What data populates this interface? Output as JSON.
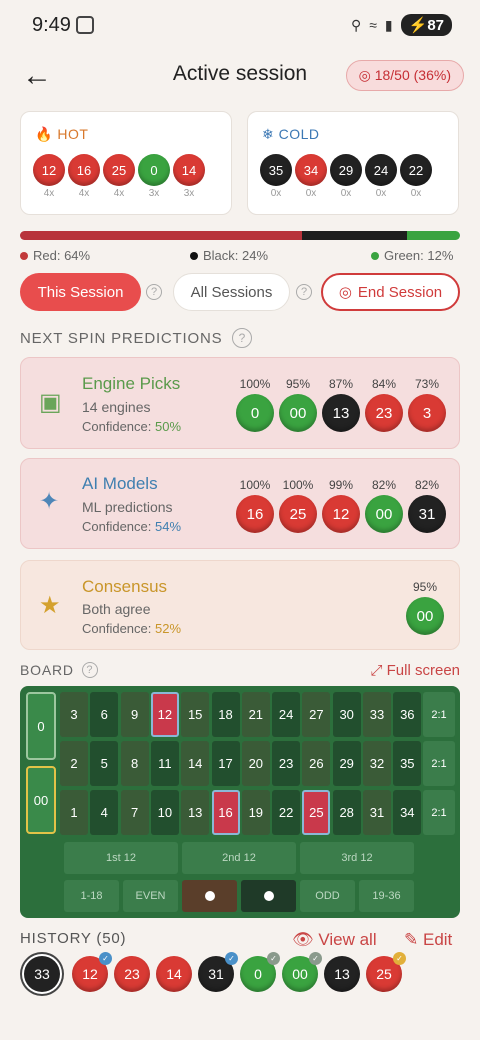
{
  "status": {
    "time": "9:49",
    "battery": "87"
  },
  "header": {
    "title": "Active session",
    "streak": "18/50 (36%)"
  },
  "hot": {
    "label": "HOT",
    "balls": [
      {
        "n": "12",
        "c": "red",
        "count": "4x"
      },
      {
        "n": "16",
        "c": "red",
        "count": "4x"
      },
      {
        "n": "25",
        "c": "red",
        "count": "4x"
      },
      {
        "n": "0",
        "c": "green",
        "count": "3x"
      },
      {
        "n": "14",
        "c": "red",
        "count": "3x"
      }
    ]
  },
  "cold": {
    "label": "COLD",
    "balls": [
      {
        "n": "35",
        "c": "black",
        "count": "0x"
      },
      {
        "n": "34",
        "c": "red",
        "count": "0x"
      },
      {
        "n": "29",
        "c": "black",
        "count": "0x"
      },
      {
        "n": "24",
        "c": "black",
        "count": "0x"
      },
      {
        "n": "22",
        "c": "black",
        "count": "0x"
      }
    ]
  },
  "ratio": {
    "red": 64,
    "black": 24,
    "green": 12,
    "red_label": "Red: 64%",
    "black_label": "Black: 24%",
    "green_label": "Green: 12%",
    "colors": {
      "red": "#b8333b",
      "black": "#1e1e1e",
      "green": "#3aa340"
    }
  },
  "buttons": {
    "this_session": "This Session",
    "all_sessions": "All Sessions",
    "end_session": "End Session",
    "q": "?"
  },
  "predictions": {
    "heading": "NEXT SPIN PREDICTIONS",
    "engine": {
      "title": "Engine Picks",
      "sub": "14 engines",
      "conf_label": "Confidence: ",
      "conf": "50%",
      "color": "#5a9a4b",
      "balls": [
        {
          "p": "100%",
          "n": "0",
          "c": "green"
        },
        {
          "p": "95%",
          "n": "00",
          "c": "green"
        },
        {
          "p": "87%",
          "n": "13",
          "c": "black"
        },
        {
          "p": "84%",
          "n": "23",
          "c": "red"
        },
        {
          "p": "73%",
          "n": "3",
          "c": "red"
        }
      ]
    },
    "ai": {
      "title": "AI Models",
      "sub": "ML predictions",
      "conf_label": "Confidence: ",
      "conf": "54%",
      "color": "#3f7fb0",
      "balls": [
        {
          "p": "100%",
          "n": "16",
          "c": "red"
        },
        {
          "p": "100%",
          "n": "25",
          "c": "red"
        },
        {
          "p": "99%",
          "n": "12",
          "c": "red"
        },
        {
          "p": "82%",
          "n": "00",
          "c": "green"
        },
        {
          "p": "82%",
          "n": "31",
          "c": "black"
        }
      ]
    },
    "consensus": {
      "title": "Consensus",
      "sub": "Both agree",
      "conf_label": "Confidence: ",
      "conf": "52%",
      "color": "#c9962a",
      "balls": [
        {
          "p": "95%",
          "n": "00",
          "c": "green"
        }
      ]
    }
  },
  "board": {
    "label": "BOARD",
    "fullscreen": "Full screen",
    "rows": [
      [
        "3",
        "6",
        "9",
        "12",
        "15",
        "18",
        "21",
        "24",
        "27",
        "30",
        "33",
        "36"
      ],
      [
        "2",
        "5",
        "8",
        "11",
        "14",
        "17",
        "20",
        "23",
        "26",
        "29",
        "32",
        "35"
      ],
      [
        "1",
        "4",
        "7",
        "10",
        "13",
        "16",
        "19",
        "22",
        "25",
        "28",
        "31",
        "34"
      ]
    ],
    "selected": [
      "12",
      "16",
      "25"
    ],
    "zero": "0",
    "double_zero": "00",
    "column": "2:1",
    "dozens": [
      "1st 12",
      "2nd 12",
      "3rd 12"
    ],
    "outside": [
      "1-18",
      "EVEN",
      "",
      "",
      "ODD",
      "19-36"
    ]
  },
  "history": {
    "label": "HISTORY (50)",
    "view_all": "View all",
    "edit": "Edit",
    "balls": [
      {
        "n": "33",
        "c": "black",
        "mark": ""
      },
      {
        "n": "12",
        "c": "red",
        "mark": "blue"
      },
      {
        "n": "23",
        "c": "red",
        "mark": ""
      },
      {
        "n": "14",
        "c": "red",
        "mark": ""
      },
      {
        "n": "31",
        "c": "black",
        "mark": "blue"
      },
      {
        "n": "0",
        "c": "green",
        "mark": "gray"
      },
      {
        "n": "00",
        "c": "green",
        "mark": "gray"
      },
      {
        "n": "13",
        "c": "black",
        "mark": ""
      },
      {
        "n": "25",
        "c": "red",
        "mark": "gold"
      }
    ]
  }
}
